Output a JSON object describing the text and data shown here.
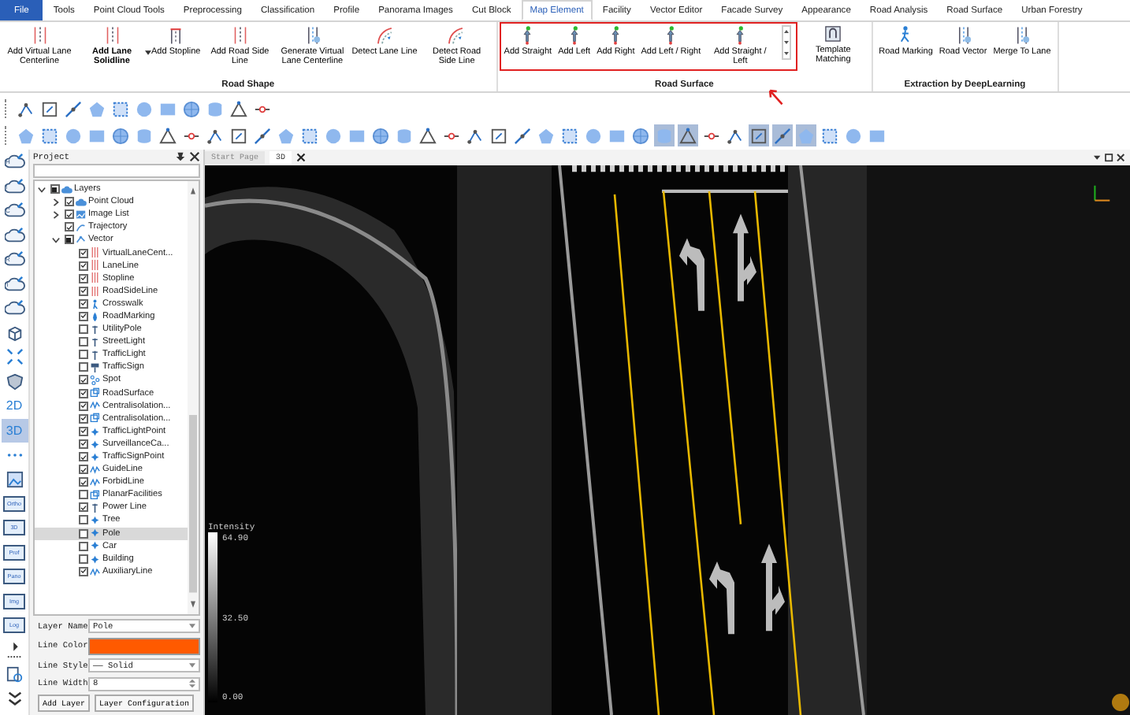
{
  "menu_tabs": [
    {
      "label": "File",
      "kind": "file",
      "selected": false
    },
    {
      "label": "Tools",
      "kind": "tab",
      "selected": false
    },
    {
      "label": "Point Cloud Tools",
      "kind": "tab",
      "selected": false
    },
    {
      "label": "Preprocessing",
      "kind": "tab",
      "selected": false
    },
    {
      "label": "Classification",
      "kind": "tab",
      "selected": false
    },
    {
      "label": "Profile",
      "kind": "tab",
      "selected": false
    },
    {
      "label": "Panorama Images",
      "kind": "tab",
      "selected": false
    },
    {
      "label": "Cut Block",
      "kind": "tab",
      "selected": false
    },
    {
      "label": "Map Element",
      "kind": "tab",
      "selected": true
    },
    {
      "label": "Facility",
      "kind": "tab",
      "selected": false
    },
    {
      "label": "Vector Editor",
      "kind": "tab",
      "selected": false
    },
    {
      "label": "Facade Survey",
      "kind": "tab",
      "selected": false
    },
    {
      "label": "Appearance",
      "kind": "tab",
      "selected": false
    },
    {
      "label": "Road Analysis",
      "kind": "tab",
      "selected": false
    },
    {
      "label": "Road Surface",
      "kind": "tab",
      "selected": false
    },
    {
      "label": "Urban Forestry",
      "kind": "tab",
      "selected": false
    }
  ],
  "ribbon_groups": [
    {
      "title": "Road Shape",
      "highlighted": false,
      "buttons": [
        {
          "label": "Add Virtual Lane Centerline",
          "kind": "lane"
        },
        {
          "label": "Add Lane Solidline",
          "kind": "lane-split"
        },
        {
          "label": "Add Stopline",
          "kind": "stop"
        },
        {
          "label": "Add Road Side Line",
          "kind": "lane"
        },
        {
          "label": "Generate Virtual Lane Centerline",
          "kind": "generate"
        },
        {
          "label": "Detect Lane Line",
          "kind": "detect"
        },
        {
          "label": "Detect Road Side Line",
          "kind": "road"
        }
      ]
    },
    {
      "title": "Road Surface",
      "highlighted": true,
      "buttons": [
        {
          "label": "Add Straight",
          "kind": "arrow"
        },
        {
          "label": "Add Left",
          "kind": "arrow"
        },
        {
          "label": "Add Right",
          "kind": "arrow"
        },
        {
          "label": "Add Left / Right",
          "kind": "arrow"
        },
        {
          "label": "Add Straight / Left",
          "kind": "arrow"
        },
        {
          "label": "Template Matching",
          "kind": "template"
        }
      ]
    },
    {
      "title": "Extraction by DeepLearning",
      "highlighted": false,
      "buttons": [
        {
          "label": "Road Marking",
          "kind": "person"
        },
        {
          "label": "Road Vector",
          "kind": "vector"
        },
        {
          "label": "Merge To Lane",
          "kind": "merge"
        }
      ]
    }
  ],
  "toolbar_rows": [
    [
      {
        "selected": false
      },
      {
        "selected": false
      },
      {
        "selected": false
      },
      {
        "selected": false
      },
      {
        "selected": false
      },
      {
        "selected": false
      },
      {
        "selected": false
      },
      {
        "selected": false
      },
      {
        "selected": false
      },
      {
        "selected": false
      },
      {
        "selected": false
      }
    ],
    [
      {
        "selected": false
      },
      {
        "selected": false
      },
      {
        "selected": false
      },
      {
        "selected": false
      },
      {
        "selected": false
      },
      {
        "selected": false
      },
      {
        "selected": false
      },
      {
        "selected": false
      },
      {
        "selected": false
      },
      {
        "selected": false
      },
      {
        "selected": false
      },
      {
        "selected": false
      },
      {
        "selected": false
      },
      {
        "selected": false
      },
      {
        "selected": false
      },
      {
        "selected": false
      },
      {
        "selected": false
      },
      {
        "selected": false
      },
      {
        "selected": false
      },
      {
        "selected": false
      },
      {
        "selected": false
      },
      {
        "selected": false
      },
      {
        "selected": false
      },
      {
        "selected": false
      },
      {
        "selected": false
      },
      {
        "selected": false
      },
      {
        "selected": false
      },
      {
        "selected": true
      },
      {
        "selected": true
      },
      {
        "selected": false
      },
      {
        "selected": false
      },
      {
        "selected": true
      },
      {
        "selected": true
      },
      {
        "selected": true
      },
      {
        "selected": false
      },
      {
        "selected": false
      },
      {
        "selected": false
      }
    ]
  ],
  "left_toolbar": [
    {
      "kind": "cloud",
      "label": "H",
      "selected": false
    },
    {
      "kind": "cloud",
      "label": "I",
      "selected": false
    },
    {
      "kind": "cloud",
      "label": "C",
      "selected": false
    },
    {
      "kind": "cloud",
      "selected": false
    },
    {
      "kind": "cloud",
      "label": "R",
      "selected": false
    },
    {
      "kind": "cloud",
      "label": "T",
      "selected": false
    },
    {
      "kind": "cloud",
      "selected": false
    },
    {
      "kind": "cube",
      "selected": false
    },
    {
      "kind": "expand",
      "selected": false
    },
    {
      "kind": "shield",
      "selected": false
    },
    {
      "kind": "text",
      "label": "2D",
      "selected": false
    },
    {
      "kind": "text",
      "label": "3D",
      "selected": true
    },
    {
      "kind": "dots",
      "selected": false
    },
    {
      "kind": "image",
      "selected": false
    },
    {
      "kind": "doc",
      "label": "Ortho",
      "selected": false
    },
    {
      "kind": "doc",
      "label": "3D",
      "selected": false
    },
    {
      "kind": "doc",
      "label": "Prof",
      "selected": false
    },
    {
      "kind": "doc",
      "label": "Pano",
      "selected": false
    },
    {
      "kind": "doc",
      "label": "Img",
      "selected": false
    },
    {
      "kind": "doc",
      "label": "Log",
      "selected": false
    },
    {
      "kind": "more",
      "selected": false
    },
    {
      "kind": "search",
      "selected": false
    },
    {
      "kind": "collapse",
      "selected": false
    }
  ],
  "project_panel": {
    "title": "Project",
    "tree": [
      {
        "label": "Layers",
        "kind": "layers",
        "checked": false,
        "partial": true,
        "expanded": true,
        "selected": false,
        "children": [
          {
            "label": "Point Cloud",
            "kind": "cloud",
            "checked": true,
            "partial": false,
            "expanded": false,
            "selected": false
          },
          {
            "label": "Image List",
            "kind": "image",
            "checked": true,
            "partial": false,
            "expanded": false,
            "selected": false
          },
          {
            "label": "Trajectory",
            "kind": "trajectory",
            "checked": true,
            "partial": false,
            "selected": false
          },
          {
            "label": "Vector",
            "kind": "vector",
            "checked": false,
            "partial": true,
            "expanded": true,
            "selected": false,
            "children": [
              {
                "label": "VirtualLaneCent...",
                "kind": "line",
                "checked": true,
                "partial": false,
                "selected": false
              },
              {
                "label": "LaneLine",
                "kind": "line",
                "checked": true,
                "partial": false,
                "selected": false
              },
              {
                "label": "Stopline",
                "kind": "line",
                "checked": true,
                "partial": false,
                "selected": false
              },
              {
                "label": "RoadSideLine",
                "kind": "line",
                "checked": true,
                "partial": false,
                "selected": false
              },
              {
                "label": "Crosswalk",
                "kind": "person",
                "checked": true,
                "partial": false,
                "selected": false
              },
              {
                "label": "RoadMarking",
                "kind": "drop",
                "checked": true,
                "partial": false,
                "selected": false
              },
              {
                "label": "UtilityPole",
                "kind": "pole",
                "checked": false,
                "partial": false,
                "selected": false
              },
              {
                "label": "StreetLight",
                "kind": "pole",
                "checked": false,
                "partial": false,
                "selected": false
              },
              {
                "label": "TrafficLight",
                "kind": "pole",
                "checked": false,
                "partial": false,
                "selected": false
              },
              {
                "label": "TrafficSign",
                "kind": "sign",
                "checked": false,
                "partial": false,
                "selected": false
              },
              {
                "label": "Spot",
                "kind": "points",
                "checked": true,
                "partial": false,
                "selected": false
              },
              {
                "label": "RoadSurface",
                "kind": "area",
                "checked": true,
                "partial": false,
                "selected": false
              },
              {
                "label": "Centralisolation...",
                "kind": "wave",
                "checked": true,
                "partial": false,
                "selected": false
              },
              {
                "label": "Centralisolation...",
                "kind": "area",
                "checked": true,
                "partial": false,
                "selected": false
              },
              {
                "label": "TrafficLightPoint",
                "kind": "dot",
                "checked": true,
                "partial": false,
                "selected": false
              },
              {
                "label": "SurveillanceCa...",
                "kind": "dot",
                "checked": true,
                "partial": false,
                "selected": false
              },
              {
                "label": "TrafficSignPoint",
                "kind": "dot",
                "checked": true,
                "partial": false,
                "selected": false
              },
              {
                "label": "GuideLine",
                "kind": "wave",
                "checked": true,
                "partial": false,
                "selected": false
              },
              {
                "label": "ForbidLine",
                "kind": "wave",
                "checked": true,
                "partial": false,
                "selected": false
              },
              {
                "label": "PlanarFacilities",
                "kind": "area",
                "checked": false,
                "partial": false,
                "selected": false
              },
              {
                "label": "Power Line",
                "kind": "pole",
                "checked": true,
                "partial": false,
                "selected": false
              },
              {
                "label": "Tree",
                "kind": "dot",
                "checked": false,
                "partial": false,
                "selected": false
              },
              {
                "label": "Pole",
                "kind": "dot",
                "checked": false,
                "partial": false,
                "selected": true
              },
              {
                "label": "Car",
                "kind": "dot",
                "checked": false,
                "partial": false,
                "selected": false
              },
              {
                "label": "Building",
                "kind": "dot",
                "checked": false,
                "partial": false,
                "selected": false
              },
              {
                "label": "AuxiliaryLine",
                "kind": "wave",
                "checked": true,
                "partial": false,
                "selected": false
              }
            ]
          }
        ]
      }
    ],
    "properties": [
      {
        "label": "Layer Name",
        "kind": "dropdown",
        "value": "Pole"
      },
      {
        "label": "Line Color",
        "kind": "color",
        "color": "#ff5a00"
      },
      {
        "label": "Line Style",
        "kind": "dropdown",
        "value": "—— Solid"
      },
      {
        "label": "Line Width",
        "kind": "spin",
        "value": "8"
      }
    ],
    "buttons": [
      "Add Layer",
      "Layer Configuration"
    ]
  },
  "viewport": {
    "tabs": [
      {
        "label": "Start Page",
        "selected": false
      },
      {
        "label": "3D",
        "selected": true
      }
    ],
    "legend": {
      "title": "Intensity",
      "max": "64.90",
      "mid": "32.50",
      "min": "0.00"
    }
  }
}
